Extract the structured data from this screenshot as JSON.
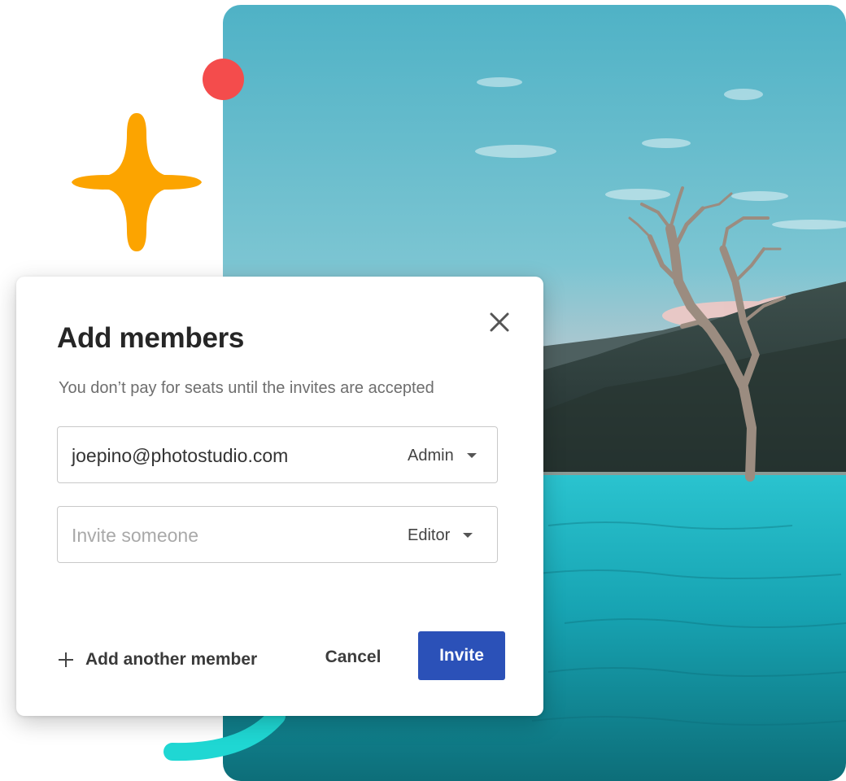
{
  "colors": {
    "accent": "#2b51b8",
    "dot": "#f44c4c",
    "star": "#fca400",
    "arc": "#1fd7d3",
    "sky_top": "#4fb4c8",
    "water": "#1a9cab"
  },
  "dialog": {
    "title": "Add members",
    "subtitle": "You don’t pay for seats until the invites are accepted",
    "close_icon": "close-icon",
    "members": [
      {
        "value": "joepino@photostudio.com",
        "placeholder": "",
        "role": "Admin"
      },
      {
        "value": "",
        "placeholder": "Invite someone",
        "role": "Editor"
      }
    ],
    "add_another_label": "Add another member",
    "add_icon": "plus-icon",
    "cancel_label": "Cancel",
    "invite_label": "Invite"
  },
  "decorations": {
    "photo": "landscape-tree-in-lake",
    "shapes": [
      "red-dot",
      "four-point-star",
      "teal-arc"
    ]
  }
}
